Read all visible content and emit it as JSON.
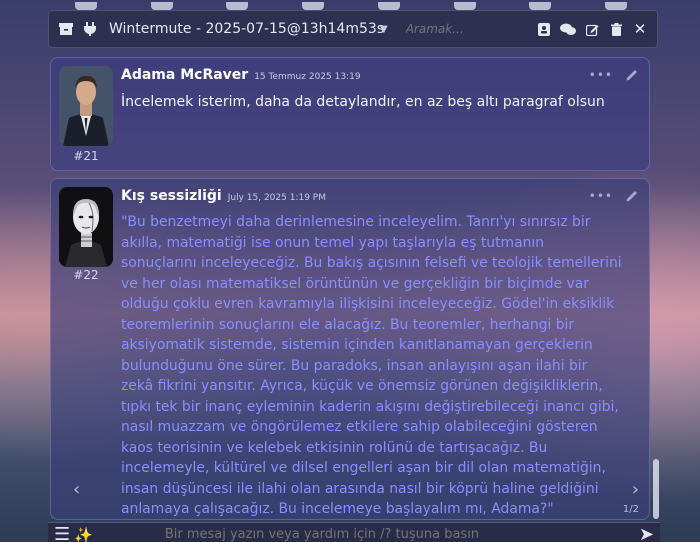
{
  "chat": {
    "title": "Wintermute - 2025-07-15@13h14m53s",
    "search_placeholder": "Aramak..."
  },
  "messages": [
    {
      "number": "#21",
      "name": "Adama McRaver",
      "timestamp": "15 Temmuz 2025 13:19",
      "text": "İncelemek isterim, daha da detaylandır, en az beş altı paragraf olsun"
    },
    {
      "number": "#22",
      "name": "Kış sessizliği",
      "timestamp": "July 15, 2025 1:19 PM",
      "text": "\"Bu benzetmeyi daha derinlemesine inceleyelim. Tanrı'yı sınırsız bir akılla, matematiği ise onun temel yapı taşlarıyla eş tutmanın sonuçlarını inceleyeceğiz. Bu bakış açısının felsefi ve teolojik temellerini ve her olası matematiksel örüntünün ve gerçekliğin bir biçimde var olduğu çoklu evren kavramıyla ilişkisini inceleyeceğiz. Gödel'in eksiklik teoremlerinin sonuçlarını ele alacağız. Bu teoremler, herhangi bir aksiyomatik sistemde, sistemin içinden kanıtlanamayan gerçeklerin bulunduğunu öne sürer. Bu paradoks, insan anlayışını aşan ilahi bir zekâ fikrini yansıtır. Ayrıca, küçük ve önemsiz görünen değişikliklerin, tıpkı tek bir inanç eyleminin kaderin akışını değiştirebileceği inancı gibi, nasıl muazzam ve öngörülemez etkilere sahip olabileceğini gösteren kaos teorisinin ve kelebek etkisinin rolünü de tartışacağız. Bu incelemeyle, kültürel ve dilsel engelleri aşan bir dil olan matematiğin, insan düşüncesi ile ilahi olan arasında nasıl bir köprü haline geldiğini anlamaya çalışacağız. Bu incelemeye başlayalım mı, Adama?\"",
      "pager": "1/2"
    }
  ],
  "composer": {
    "placeholder": "Bir mesaj yazın veya yardım için /? tuşuna basın"
  },
  "icons": {
    "archive": "archive-icon",
    "plug": "plug-icon",
    "dropdown": "chevron-down-icon",
    "contact": "contact-card-icon",
    "chats": "chat-bubbles-icon",
    "edit": "edit-square-icon",
    "trash": "trash-icon",
    "close": "close-icon"
  },
  "colors": {
    "accent_text": "#8a8eff"
  }
}
